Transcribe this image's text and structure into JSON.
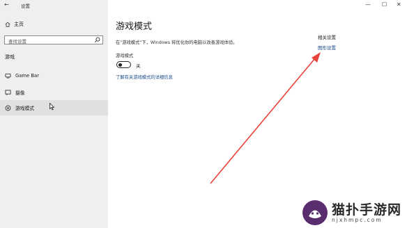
{
  "window": {
    "title": "设置",
    "back_glyph": "←",
    "min_glyph": "—",
    "max_glyph": "☐",
    "close_glyph": "✕"
  },
  "sidebar": {
    "home_label": "主页",
    "search_placeholder": "查找设置",
    "section_title": "游戏",
    "items": [
      {
        "label": "Game Bar",
        "icon": "game-bar-icon",
        "active": false
      },
      {
        "label": "摄像",
        "icon": "capture-icon",
        "active": false
      },
      {
        "label": "游戏模式",
        "icon": "game-mode-icon",
        "active": true
      }
    ]
  },
  "main": {
    "title": "游戏模式",
    "description": "在\"游戏模式\"下，Windows 将优化你的电脑以改善游戏体验。",
    "toggle_label": "游戏模式",
    "toggle_state": "关",
    "learn_more_link": "了解有关游戏模式的详细信息"
  },
  "related": {
    "heading": "相关设置",
    "link": "图形设置"
  },
  "annotation": {
    "arrow_color": "#e8423a"
  },
  "watermark": {
    "text": "猫扑手游网",
    "url": "njxhmpc.com"
  }
}
